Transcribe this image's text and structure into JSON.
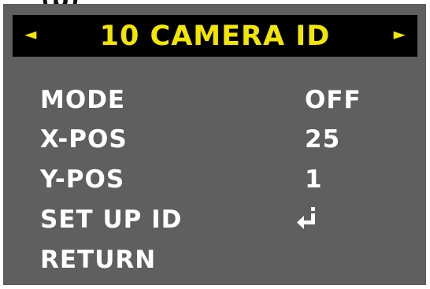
{
  "top_fragment": "(b)",
  "header": {
    "left_arrow": "◄",
    "title": "10  CAMERA ID",
    "right_arrow": "►"
  },
  "menu": {
    "items": [
      {
        "label": "MODE",
        "value": "OFF"
      },
      {
        "label": "X-POS",
        "value": "25"
      },
      {
        "label": "Y-POS",
        "value": "1"
      },
      {
        "label": "SET UP ID",
        "icon": "enter-return-icon"
      },
      {
        "label": "RETURN"
      }
    ]
  },
  "colors": {
    "panel_bg": "#5f5f5f",
    "header_bg": "#000000",
    "header_text": "#f2e600",
    "menu_text": "#ffffff"
  }
}
